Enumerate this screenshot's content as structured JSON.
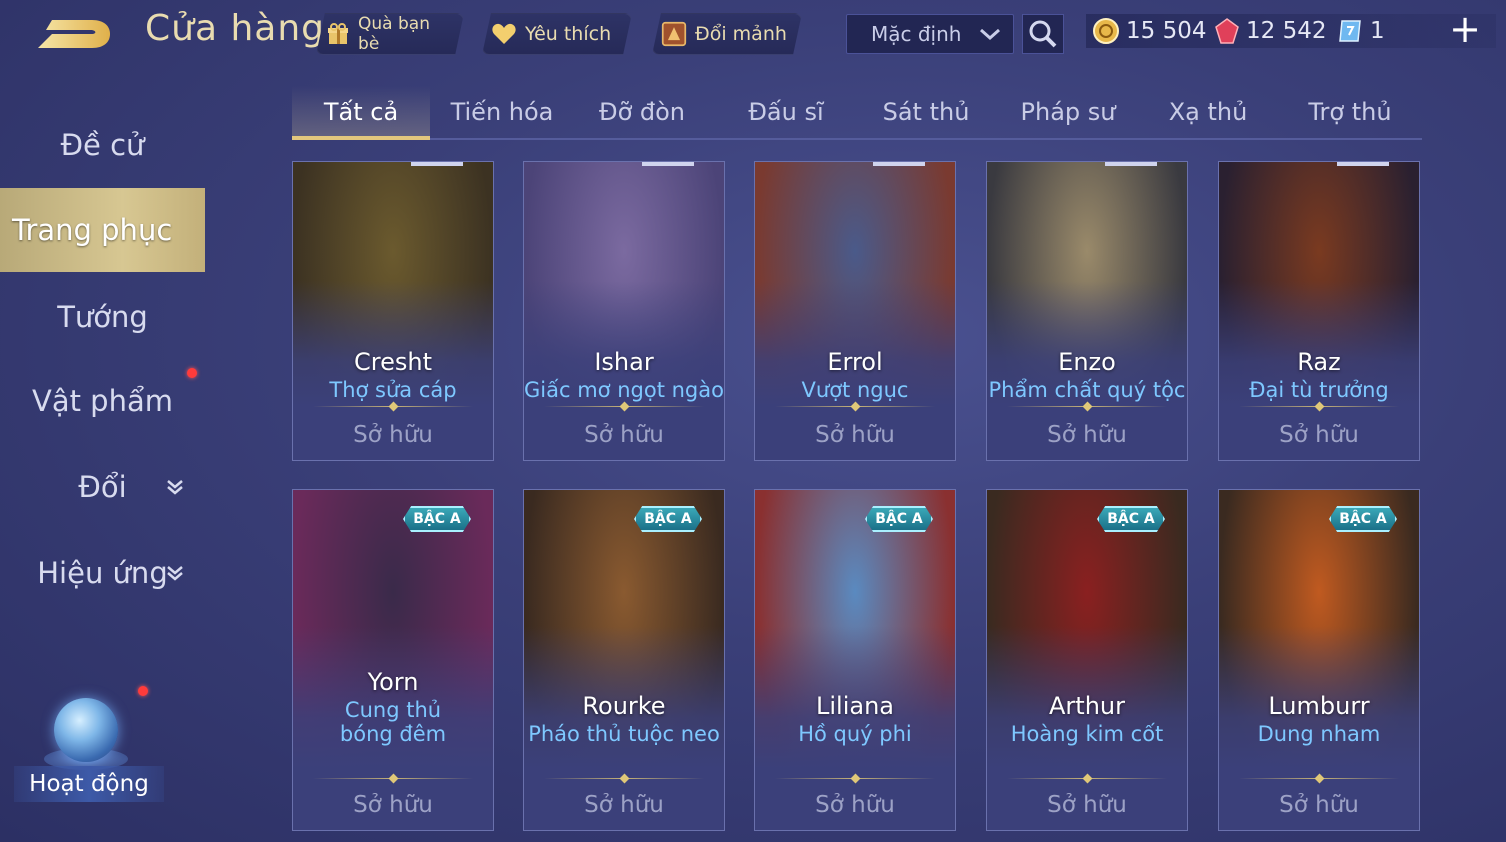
{
  "header": {
    "title": "Cửa hàng",
    "friend_gift": "Quà bạn bè",
    "favorites": "Yêu thích",
    "exchange_shards": "Đổi mảnh",
    "sort_value": "Mặc định"
  },
  "currency": {
    "gold": "15 504",
    "gems": "12 542",
    "vouchers": "1"
  },
  "sidebar": {
    "items": [
      {
        "label": "Đề cử"
      },
      {
        "label": "Trang phục"
      },
      {
        "label": "Tướng"
      },
      {
        "label": "Vật phẩm"
      },
      {
        "label": "Đổi"
      },
      {
        "label": "Hiệu ứng"
      }
    ],
    "activity": "Hoạt động"
  },
  "tabs": [
    "Tất cả",
    "Tiến hóa",
    "Đỡ đòn",
    "Đấu sĩ",
    "Sát thủ",
    "Pháp sư",
    "Xạ thủ",
    "Trợ thủ"
  ],
  "cards": [
    {
      "hero": "Cresht",
      "skin": "Thợ sửa cáp",
      "status": "Sở hữu",
      "badge": "",
      "colors": [
        "#6b5a2e",
        "#3c3222"
      ]
    },
    {
      "hero": "Ishar",
      "skin": "Giấc mơ ngọt ngào",
      "status": "Sở hữu",
      "badge": "",
      "colors": [
        "#7b6aa0",
        "#4c4478"
      ]
    },
    {
      "hero": "Errol",
      "skin": "Vượt ngục",
      "status": "Sở hữu",
      "badge": "",
      "colors": [
        "#4a5a8a",
        "#7a3a30"
      ]
    },
    {
      "hero": "Enzo",
      "skin": "Phẩm chất quý tộc",
      "status": "Sở hữu",
      "badge": "",
      "colors": [
        "#9a8a6a",
        "#3a3a40"
      ]
    },
    {
      "hero": "Raz",
      "skin": "Đại tù trưởng",
      "status": "Sở hữu",
      "badge": "",
      "colors": [
        "#7a3a20",
        "#2a2030"
      ]
    },
    {
      "hero": "Yorn",
      "skin": "Cung thủ bóng đêm",
      "status": "Sở hữu",
      "badge": "BẬC A",
      "colors": [
        "#3a2a4a",
        "#6a2a5a"
      ]
    },
    {
      "hero": "Rourke",
      "skin": "Pháo thủ tuộc neo",
      "status": "Sở hữu",
      "badge": "BẬC A",
      "colors": [
        "#8a5a30",
        "#3a2a20"
      ]
    },
    {
      "hero": "Liliana",
      "skin": "Hồ quý phi",
      "status": "Sở hữu",
      "badge": "BẬC A",
      "colors": [
        "#5a8ac0",
        "#8a3030"
      ]
    },
    {
      "hero": "Arthur",
      "skin": "Hoàng kim cốt",
      "status": "Sở hữu",
      "badge": "BẬC A",
      "colors": [
        "#8a2020",
        "#3a2a20"
      ]
    },
    {
      "hero": "Lumburr",
      "skin": "Dung nham",
      "status": "Sở hữu",
      "badge": "BẬC A",
      "colors": [
        "#c05a20",
        "#3a2a20"
      ]
    }
  ]
}
